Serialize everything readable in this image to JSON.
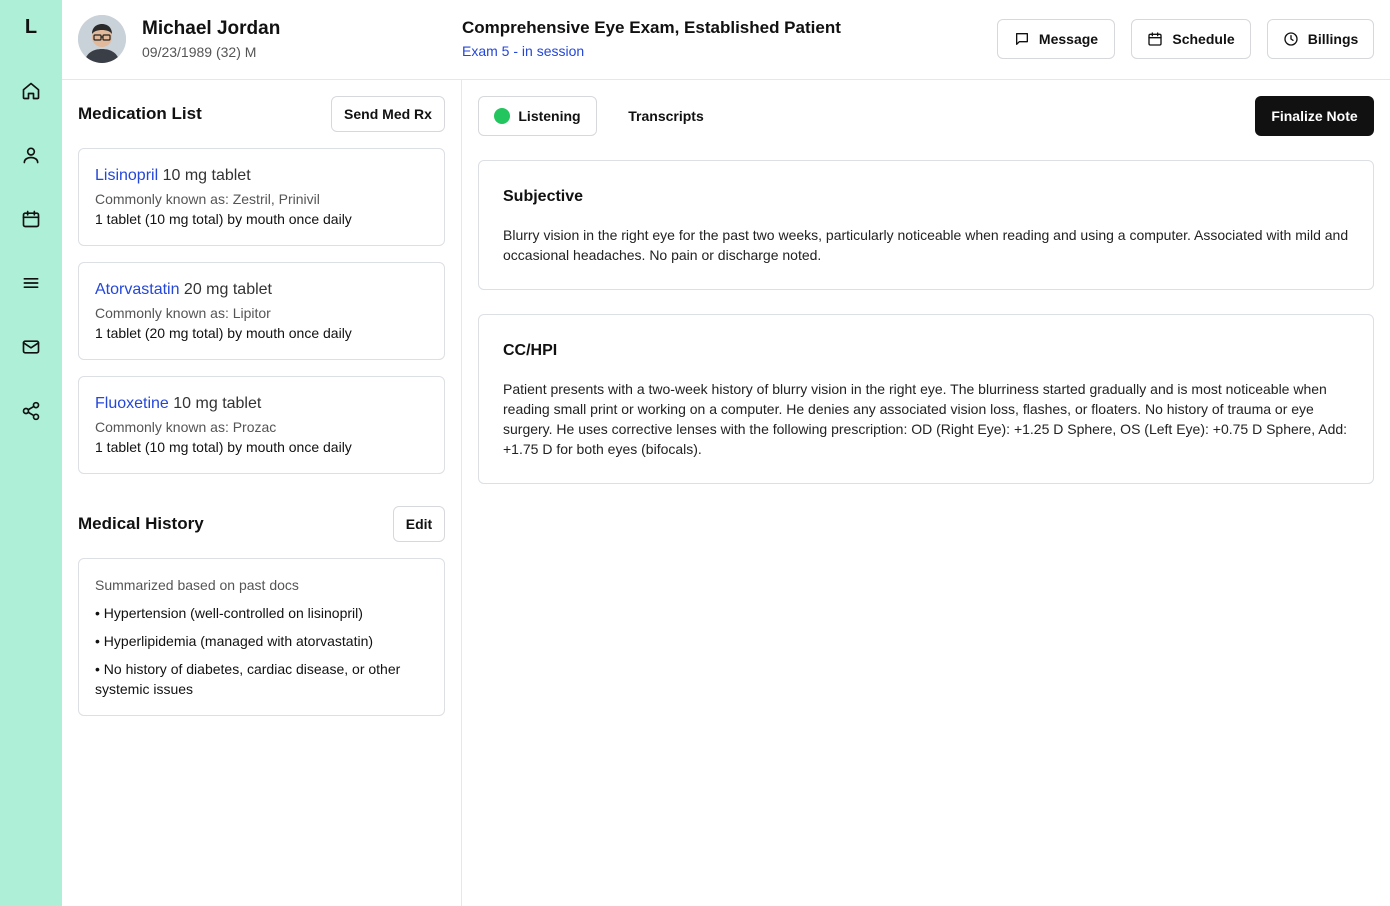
{
  "app": {
    "logo_letter": "L"
  },
  "sidebar": {
    "icons": [
      "home-icon",
      "user-icon",
      "calendar-icon",
      "menu-icon",
      "mail-icon",
      "share-icon"
    ]
  },
  "patient": {
    "name": "Michael Jordan",
    "details": "09/23/1989 (32) M"
  },
  "exam": {
    "title": "Comprehensive Eye Exam, Established Patient",
    "status": "Exam 5 - in session"
  },
  "header_actions": {
    "message": "Message",
    "schedule": "Schedule",
    "billings": "Billings"
  },
  "medications": {
    "title": "Medication List",
    "send_button": "Send Med Rx",
    "items": [
      {
        "name": "Lisinopril",
        "strength": " 10 mg tablet",
        "aka": "Commonly known as: Zestril, Prinivil",
        "sig": "1 tablet (10 mg total) by mouth once daily"
      },
      {
        "name": "Atorvastatin",
        "strength": " 20 mg tablet",
        "aka": "Commonly known as: Lipitor",
        "sig": "1 tablet (20 mg total) by mouth once daily"
      },
      {
        "name": "Fluoxetine",
        "strength": " 10 mg tablet",
        "aka": "Commonly known as: Prozac",
        "sig": "1 tablet (10 mg total) by mouth once daily"
      }
    ]
  },
  "history": {
    "title": "Medical History",
    "edit_button": "Edit",
    "note": "Summarized based on past docs",
    "items": [
      "• Hypertension (well-controlled on lisinopril)",
      "• Hyperlipidemia (managed with atorvastatin)",
      "• No history of diabetes, cardiac disease, or other systemic issues"
    ]
  },
  "session": {
    "listening_label": "Listening",
    "transcripts_tab": "Transcripts",
    "finalize_button": "Finalize Note",
    "status_color": "#22c55e"
  },
  "notes": {
    "subjective": {
      "title": "Subjective",
      "body": "Blurry vision in the right eye for the past two weeks, particularly noticeable when reading and using a computer. Associated with mild and occasional headaches. No pain or discharge noted."
    },
    "cc_hpi": {
      "title": "CC/HPI",
      "body": "Patient presents with a two-week history of blurry vision in the right eye. The blurriness started gradually and is most noticeable when reading small print or working on a computer. He denies any associated vision loss, flashes, or floaters. No history of trauma or eye surgery. He uses corrective lenses with the following prescription: OD (Right Eye): +1.25 D Sphere, OS (Left Eye): +0.75 D Sphere, Add: +1.75 D for both eyes (bifocals)."
    }
  },
  "colors": {
    "sidebar": "#aef0d7",
    "accent": "#2447d8",
    "primary_button": "#111111"
  }
}
